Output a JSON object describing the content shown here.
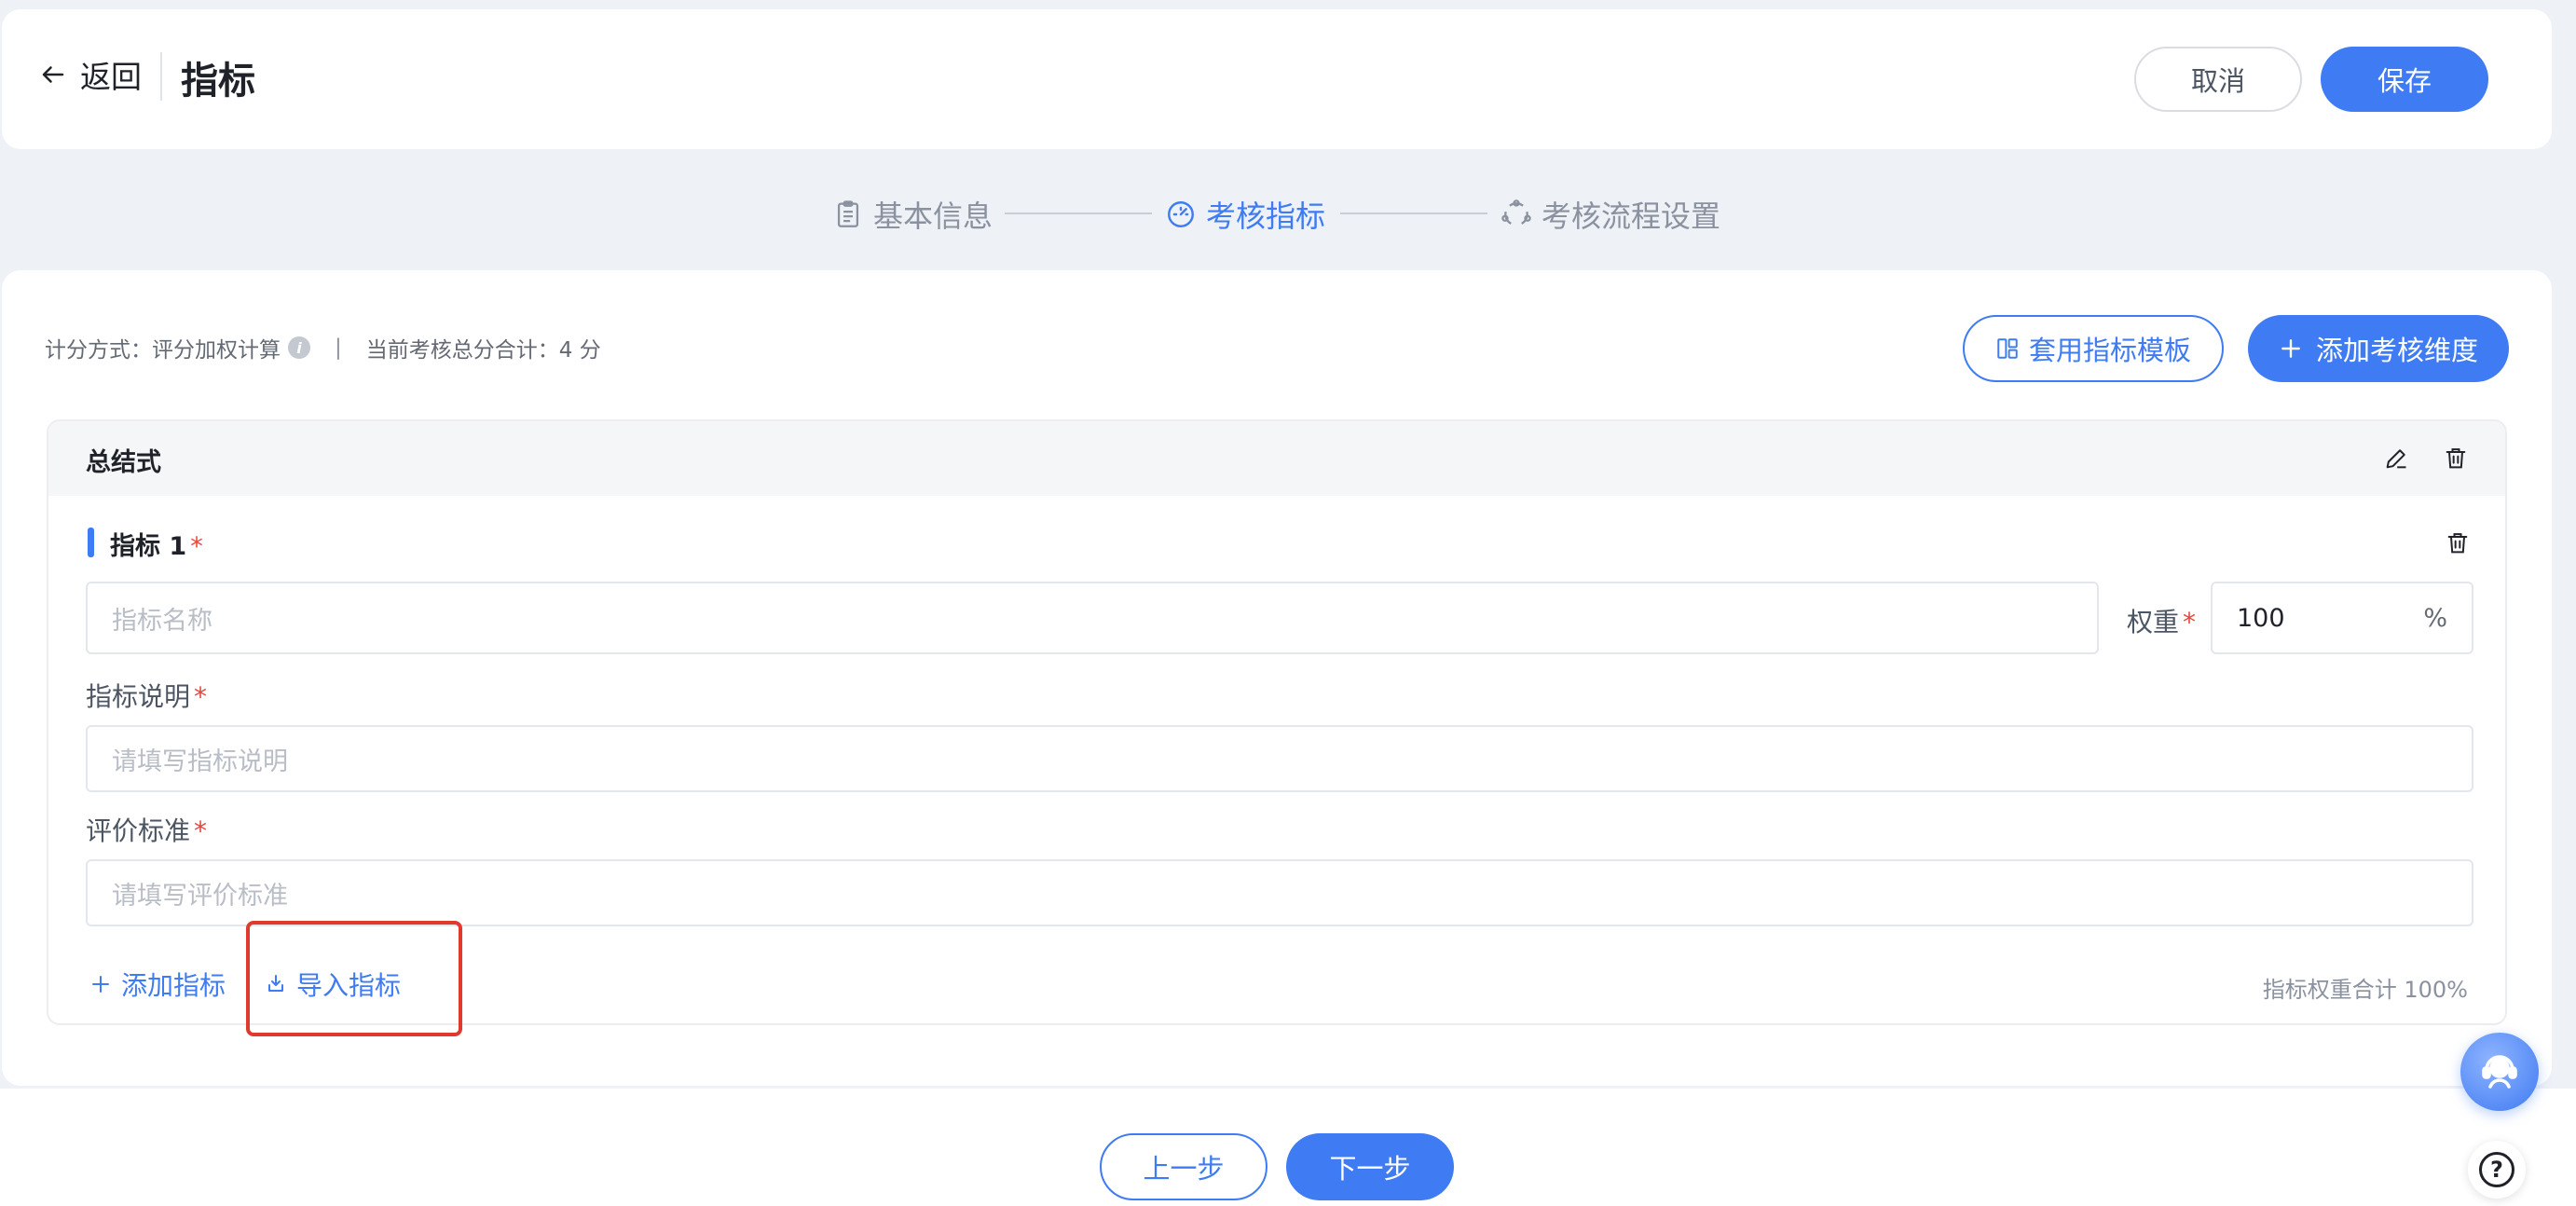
{
  "header": {
    "back_label": "返回",
    "title": "指标",
    "cancel_label": "取消",
    "save_label": "保存"
  },
  "steps": [
    {
      "label": "基本信息",
      "icon": "clipboard-icon",
      "active": false
    },
    {
      "label": "考核指标",
      "icon": "gauge-icon",
      "active": true
    },
    {
      "label": "考核流程设置",
      "icon": "flow-cycle-icon",
      "active": false
    }
  ],
  "summary": {
    "calc_method": "计分方式：评分加权计算",
    "info_glyph": "i",
    "separator": "|",
    "total_score": "当前考核总分合计：4 分"
  },
  "toolbar": {
    "template_label": "套用指标模板",
    "add_dimension_label": "添加考核维度"
  },
  "dimension": {
    "title": "总结式",
    "indicator": {
      "title": "指标 1",
      "required_mark": "*",
      "name_placeholder": "指标名称",
      "weight_label": "权重",
      "weight_value": "100",
      "weight_unit": "%",
      "description_label": "指标说明",
      "description_placeholder": "请填写指标说明",
      "standard_label": "评价标准",
      "standard_placeholder": "请填写评价标准"
    },
    "add_indicator_label": "添加指标",
    "import_indicator_label": "导入指标",
    "weight_total": "指标权重合计 100%"
  },
  "footer": {
    "prev_label": "上一步",
    "next_label": "下一步"
  },
  "floating": {
    "help_glyph": "?"
  },
  "colors": {
    "primary": "#3f7bf2",
    "required": "#e8453c",
    "highlight_box": "#e03a2f",
    "background": "#eef1f6"
  }
}
